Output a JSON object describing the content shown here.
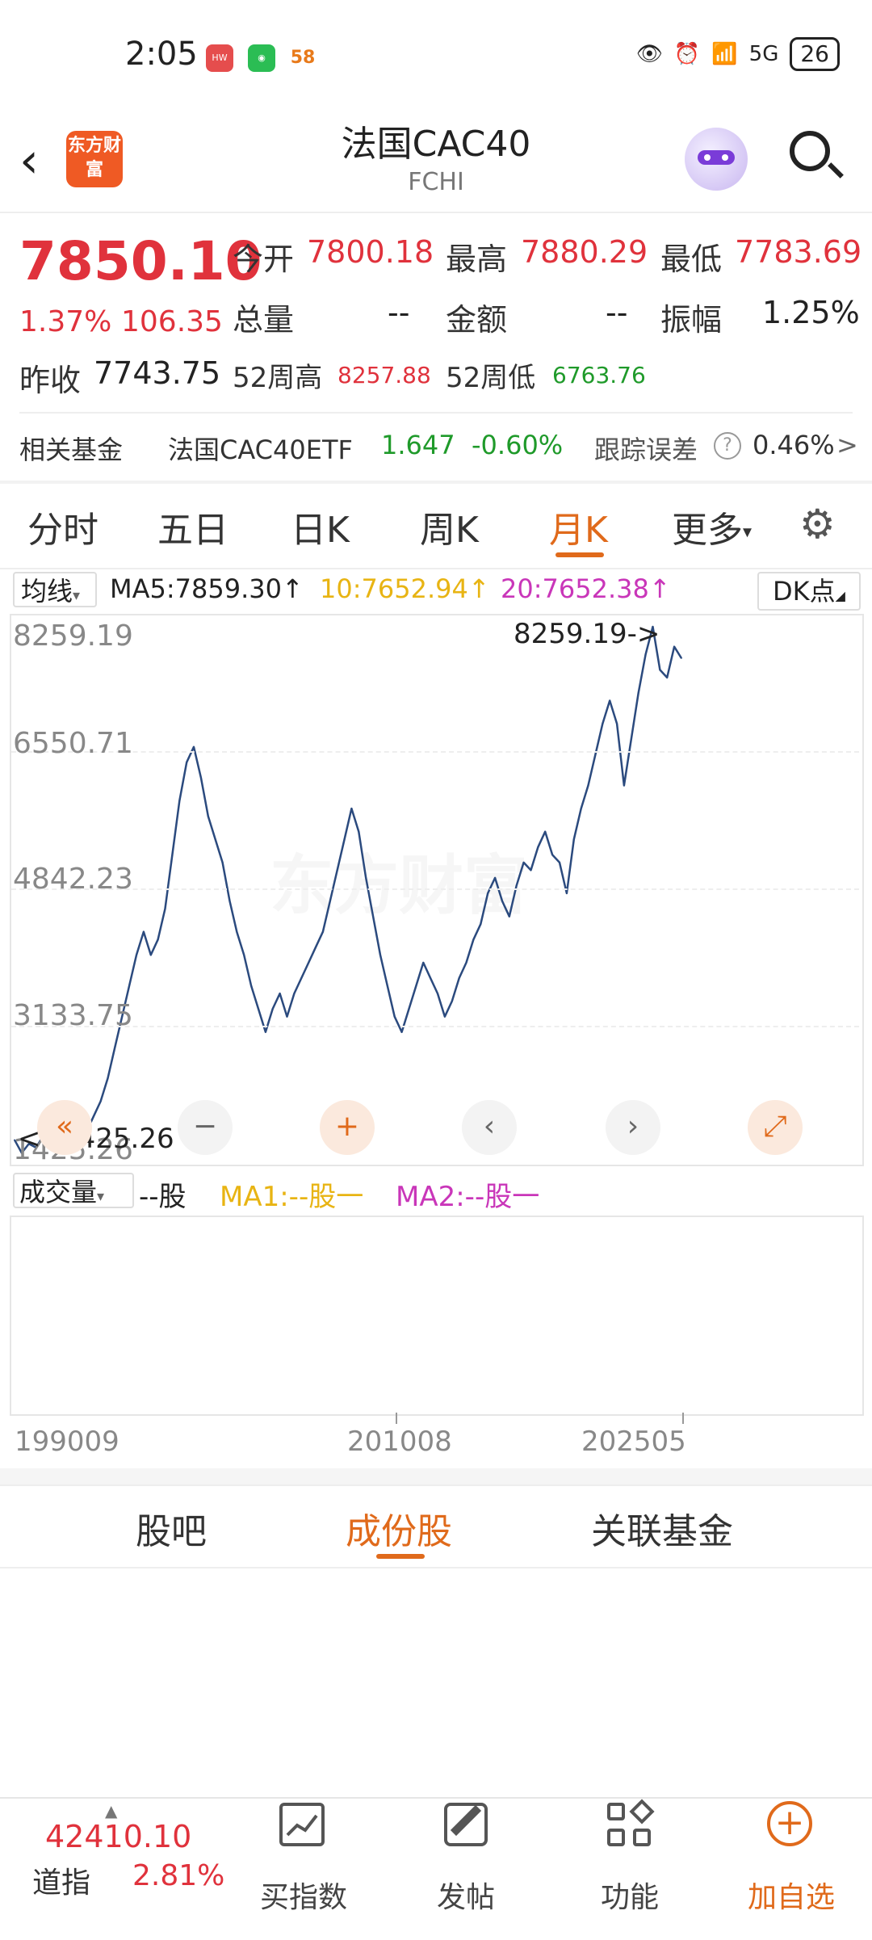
{
  "status": {
    "time": "2:05",
    "battery": "26",
    "signal": "5G"
  },
  "header": {
    "logo": "东方财富",
    "title": "法国CAC40",
    "subtitle": "FCHI"
  },
  "quote": {
    "price": "7850.10",
    "change_pct": "1.37%",
    "change": "106.35",
    "open_label": "今开",
    "open": "7800.18",
    "high_label": "最高",
    "high": "7880.29",
    "low_label": "最低",
    "low": "7783.69",
    "volume_label": "总量",
    "volume": "--",
    "amount_label": "金额",
    "amount": "--",
    "amplitude_label": "振幅",
    "amplitude": "1.25%",
    "prev_close_label": "昨收",
    "prev_close": "7743.75",
    "w52_high_label": "52周高",
    "w52_high": "8257.88",
    "w52_low_label": "52周低",
    "w52_low": "6763.76"
  },
  "fund": {
    "label": "相关基金",
    "name": "法国CAC40ETF",
    "price": "1.647",
    "change": "-0.60%",
    "tracking_label": "跟踪误差",
    "tracking": "0.46%",
    "arrow": ">"
  },
  "tabs": [
    "分时",
    "五日",
    "日K",
    "周K",
    "月K",
    "更多"
  ],
  "active_tab": "月K",
  "ma": {
    "selector": "均线",
    "ma5": "MA5:7859.30↑",
    "ma10": "10:7652.94↑",
    "ma20": "20:7652.38↑",
    "dk": "DK点"
  },
  "chart_data": {
    "type": "line",
    "yticks": [
      "8259.19",
      "6550.71",
      "4842.23",
      "3133.75",
      "1425.26"
    ],
    "ylim": [
      1425.26,
      8259.19
    ],
    "max_label": "8259.19->",
    "min_label": "<--1425.26",
    "x_ticks": [
      "199009",
      "201008",
      "202505"
    ],
    "colors": {
      "line": "#2b4a7e"
    },
    "series": [
      {
        "values": [
          1600,
          1430,
          1550,
          1500,
          1650,
          1700,
          1600,
          1750,
          1650,
          1800,
          1700,
          1900,
          2100,
          2400,
          2800,
          3200,
          3600,
          4000,
          4300,
          4000,
          4200,
          4600,
          5300,
          6000,
          6500,
          6700,
          6300,
          5800,
          5500,
          5200,
          4700,
          4300,
          4000,
          3600,
          3300,
          3000,
          3300,
          3500,
          3200,
          3500,
          3700,
          3900,
          4100,
          4300,
          4700,
          5100,
          5500,
          5900,
          5600,
          5000,
          4500,
          4000,
          3600,
          3200,
          3000,
          3300,
          3600,
          3900,
          3700,
          3500,
          3200,
          3400,
          3700,
          3900,
          4200,
          4400,
          4800,
          5000,
          4700,
          4500,
          4900,
          5200,
          5100,
          5400,
          5600,
          5300,
          5200,
          4800,
          5500,
          5900,
          6200,
          6600,
          7000,
          7300,
          7000,
          6200,
          6800,
          7400,
          7900,
          8259,
          7700,
          7600,
          8000,
          7850
        ]
      }
    ]
  },
  "controls": [
    "«",
    "−",
    "+",
    "‹",
    "›",
    "⤢"
  ],
  "volume": {
    "selector": "成交量",
    "unit": "--股",
    "ma1": "MA1:--股一",
    "ma2": "MA2:--股一"
  },
  "bottom_tabs": [
    "股吧",
    "成份股",
    "关联基金"
  ],
  "active_bottom_tab": "成份股",
  "footer": {
    "ticker_value": "42410.10",
    "ticker_name": "道指",
    "ticker_change": "2.81%",
    "items": [
      "买指数",
      "发帖",
      "功能",
      "加自选"
    ]
  },
  "watermark": "东方财富"
}
